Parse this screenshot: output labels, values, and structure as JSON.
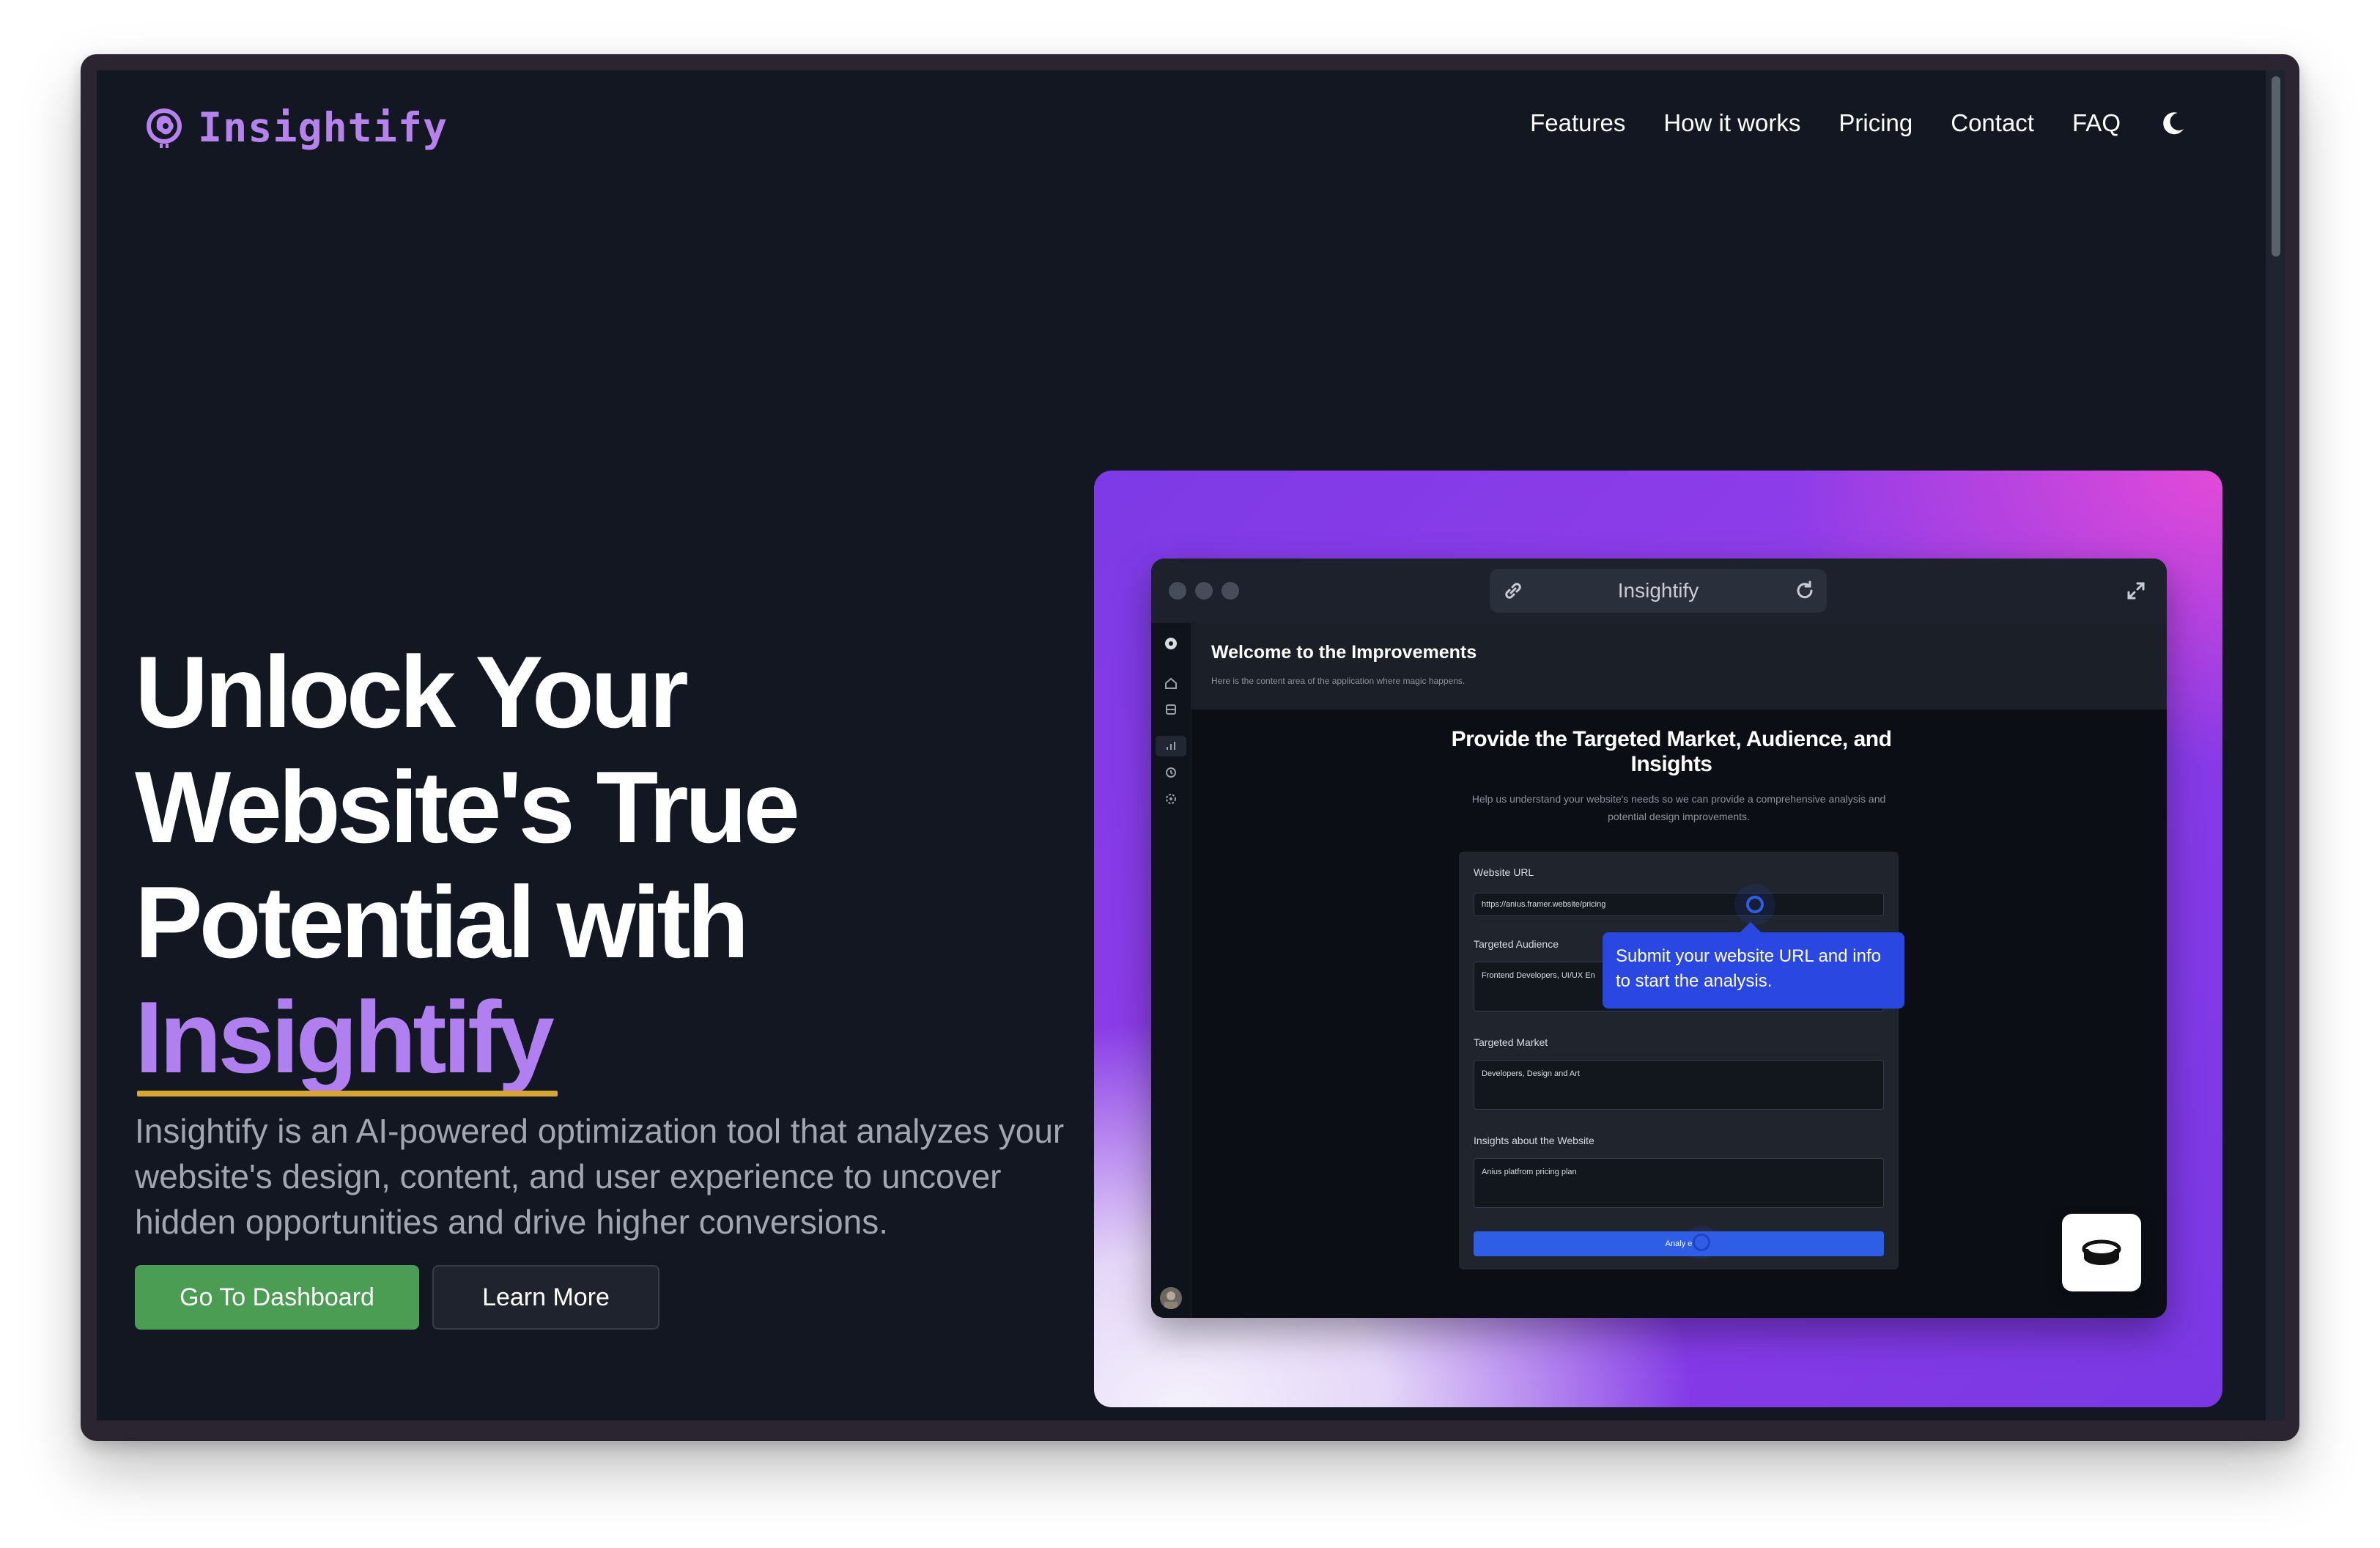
{
  "nav": {
    "logo_text": "Insightify",
    "links": [
      "Features",
      "How it works",
      "Pricing",
      "Contact",
      "FAQ"
    ],
    "theme_icon": "moon-icon"
  },
  "hero": {
    "title_lines": [
      "Unlock Your",
      "Website's True",
      "Potential with"
    ],
    "title_brand": "Insightify",
    "description": "Insightify is an AI-powered optimization tool that analyzes your website's design, content, and user experience to uncover hidden opportunities and drive higher conversions.",
    "primary_button": "Go To Dashboard",
    "secondary_button": "Learn More"
  },
  "preview": {
    "url_title": "Insightify",
    "header_title": "Welcome to the Improvements",
    "header_subtitle": "Here is the content area of the application where magic happens.",
    "main_title": "Provide the Targeted Market, Audience, and Insights",
    "main_subtitle": "Help us understand your website's needs so we can provide a comprehensive analysis and potential design improvements.",
    "form": {
      "url_label": "Website URL",
      "url_value": "https://anius.framer.website/pricing",
      "audience_label": "Targeted Audience",
      "audience_value": "Frontend Developers, UI/UX En",
      "market_label": "Targeted Market",
      "market_value": "Developers, Design and Art",
      "insights_label": "Insights about the Website",
      "insights_value": "Anius platfrom pricing plan",
      "submit_label": "Analy e"
    },
    "tooltip": "Submit your website URL and info to start the analysis."
  },
  "colors": {
    "background": "#131722",
    "brand_purple": "#b07ff0",
    "underline_gold": "#d7a531",
    "primary_green": "#4a9d52",
    "tooltip_blue": "#2b47e2"
  }
}
